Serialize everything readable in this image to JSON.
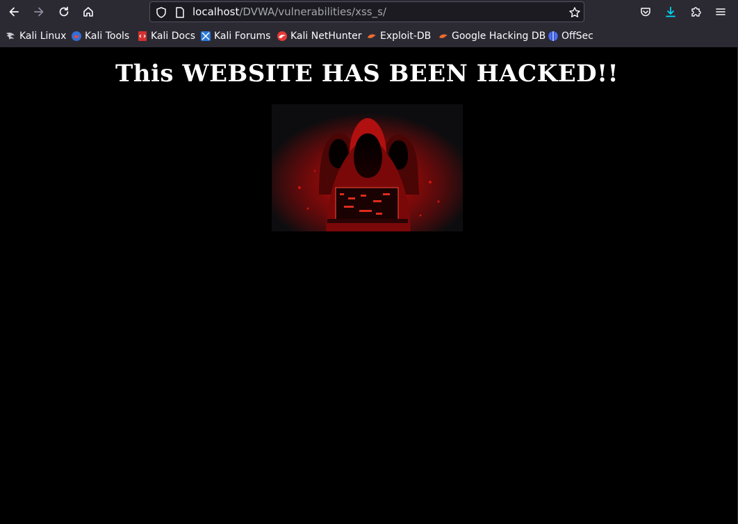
{
  "browser": {
    "url_host": "localhost",
    "url_path": "/DVWA/vulnerabilities/xss_s/",
    "bookmarks": [
      {
        "label": "Kali Linux",
        "icon": "kali-dragon-icon"
      },
      {
        "label": "Kali Tools",
        "icon": "kali-tools-icon"
      },
      {
        "label": "Kali Docs",
        "icon": "kali-docs-icon"
      },
      {
        "label": "Kali Forums",
        "icon": "kali-forums-icon"
      },
      {
        "label": "Kali NetHunter",
        "icon": "kali-nethunter-icon"
      },
      {
        "label": "Exploit-DB",
        "icon": "exploit-db-icon"
      },
      {
        "label": "Google Hacking DB",
        "icon": "ghdb-icon"
      },
      {
        "label": "OffSec",
        "icon": "offsec-icon"
      }
    ]
  },
  "page": {
    "headline": "This WEBSITE HAS BEEN HACKED!!",
    "image": "hooded-hackers-image"
  },
  "colors": {
    "chrome": "#2b2a33",
    "page_bg": "#000000",
    "accent_blue": "#00ddff",
    "hacker_red": "#e01010"
  }
}
